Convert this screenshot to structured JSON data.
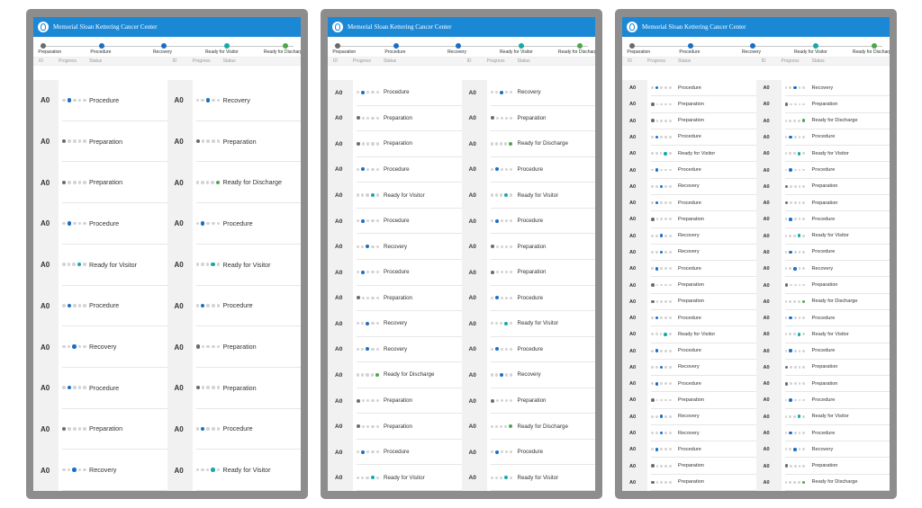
{
  "colors": {
    "header_bg": "#1b88d6",
    "preparation": "#6b6b6b",
    "procedure": "#1a6fc4",
    "recovery": "#1a6fc4",
    "ready_for_visitor": "#17a9a9",
    "ready_for_discharge": "#4ca84a",
    "inactive_dot": "#d3d3d3"
  },
  "stage_order": [
    "Preparation",
    "Procedure",
    "Recovery",
    "Ready for Visitor",
    "Ready for Discharge"
  ],
  "panels": [
    {
      "brand": "Memorial Sloan Kettering Cancer Center",
      "stages": [
        "Preparation",
        "Procedure",
        "Recovery",
        "Ready for Visitor",
        "Ready for Discharge"
      ],
      "columns": {
        "id": "ID",
        "progress": "Progress",
        "status": "Status"
      },
      "left": [
        {
          "id": "A0",
          "status": "Procedure"
        },
        {
          "id": "A0",
          "status": "Preparation"
        },
        {
          "id": "A0",
          "status": "Preparation"
        },
        {
          "id": "A0",
          "status": "Procedure"
        },
        {
          "id": "A0",
          "status": "Ready for Visitor"
        },
        {
          "id": "A0",
          "status": "Procedure"
        },
        {
          "id": "A0",
          "status": "Recovery"
        },
        {
          "id": "A0",
          "status": "Procedure"
        },
        {
          "id": "A0",
          "status": "Preparation"
        },
        {
          "id": "A0",
          "status": "Recovery"
        }
      ],
      "right": [
        {
          "id": "A0",
          "status": "Recovery"
        },
        {
          "id": "A0",
          "status": "Preparation"
        },
        {
          "id": "A0",
          "status": "Ready for Discharge"
        },
        {
          "id": "A0",
          "status": "Procedure"
        },
        {
          "id": "A0",
          "status": "Ready for Visitor"
        },
        {
          "id": "A0",
          "status": "Procedure"
        },
        {
          "id": "A0",
          "status": "Preparation"
        },
        {
          "id": "A0",
          "status": "Preparation"
        },
        {
          "id": "A0",
          "status": "Procedure"
        },
        {
          "id": "A0",
          "status": "Ready for Visitor"
        }
      ]
    },
    {
      "brand": "Memorial Sloan Kettering Cancer Center",
      "stages": [
        "Preparation",
        "Procedure",
        "Recovery",
        "Ready for Visitor",
        "Ready for Discharge"
      ],
      "columns": {
        "id": "ID",
        "progress": "Progress",
        "status": "Status"
      },
      "left": [
        {
          "id": "A0",
          "status": "Procedure"
        },
        {
          "id": "A0",
          "status": "Preparation"
        },
        {
          "id": "A0",
          "status": "Preparation"
        },
        {
          "id": "A0",
          "status": "Procedure"
        },
        {
          "id": "A0",
          "status": "Ready for Visitor"
        },
        {
          "id": "A0",
          "status": "Procedure"
        },
        {
          "id": "A0",
          "status": "Recovery"
        },
        {
          "id": "A0",
          "status": "Procedure"
        },
        {
          "id": "A0",
          "status": "Preparation"
        },
        {
          "id": "A0",
          "status": "Recovery"
        },
        {
          "id": "A0",
          "status": "Recovery"
        },
        {
          "id": "A0",
          "status": "Ready for Discharge"
        },
        {
          "id": "A0",
          "status": "Preparation"
        },
        {
          "id": "A0",
          "status": "Preparation"
        },
        {
          "id": "A0",
          "status": "Procedure"
        },
        {
          "id": "A0",
          "status": "Ready for Visitor"
        }
      ],
      "right": [
        {
          "id": "A0",
          "status": "Recovery"
        },
        {
          "id": "A0",
          "status": "Preparation"
        },
        {
          "id": "A0",
          "status": "Ready for Discharge"
        },
        {
          "id": "A0",
          "status": "Procedure"
        },
        {
          "id": "A0",
          "status": "Ready for Visitor"
        },
        {
          "id": "A0",
          "status": "Procedure"
        },
        {
          "id": "A0",
          "status": "Preparation"
        },
        {
          "id": "A0",
          "status": "Preparation"
        },
        {
          "id": "A0",
          "status": "Procedure"
        },
        {
          "id": "A0",
          "status": "Ready for Visitor"
        },
        {
          "id": "A0",
          "status": "Procedure"
        },
        {
          "id": "A0",
          "status": "Recovery"
        },
        {
          "id": "A0",
          "status": "Preparation"
        },
        {
          "id": "A0",
          "status": "Ready for Discharge"
        },
        {
          "id": "A0",
          "status": "Procedure"
        },
        {
          "id": "A0",
          "status": "Ready for Visitor"
        }
      ]
    },
    {
      "brand": "Memorial Sloan Kettering Cancer Center",
      "stages": [
        "Preparation",
        "Procedure",
        "Recovery",
        "Ready for Visitor",
        "Ready for Discharge"
      ],
      "columns": {
        "id": "ID",
        "progress": "Progress",
        "status": "Status"
      },
      "left": [
        {
          "id": "A0",
          "status": "Procedure"
        },
        {
          "id": "A0",
          "status": "Preparation"
        },
        {
          "id": "A0",
          "status": "Preparation"
        },
        {
          "id": "A0",
          "status": "Procedure"
        },
        {
          "id": "A0",
          "status": "Ready for Visitor"
        },
        {
          "id": "A0",
          "status": "Procedure"
        },
        {
          "id": "A0",
          "status": "Recovery"
        },
        {
          "id": "A0",
          "status": "Procedure"
        },
        {
          "id": "A0",
          "status": "Preparation"
        },
        {
          "id": "A0",
          "status": "Recovery"
        },
        {
          "id": "A0",
          "status": "Recovery"
        },
        {
          "id": "A0",
          "status": "Procedure"
        },
        {
          "id": "A0",
          "status": "Preparation"
        },
        {
          "id": "A0",
          "status": "Preparation"
        },
        {
          "id": "A0",
          "status": "Procedure"
        },
        {
          "id": "A0",
          "status": "Ready for Visitor"
        },
        {
          "id": "A0",
          "status": "Procedure"
        },
        {
          "id": "A0",
          "status": "Recovery"
        },
        {
          "id": "A0",
          "status": "Procedure"
        },
        {
          "id": "A0",
          "status": "Preparation"
        },
        {
          "id": "A0",
          "status": "Recovery"
        },
        {
          "id": "A0",
          "status": "Recovery"
        },
        {
          "id": "A0",
          "status": "Procedure"
        },
        {
          "id": "A0",
          "status": "Preparation"
        },
        {
          "id": "A0",
          "status": "Preparation"
        }
      ],
      "right": [
        {
          "id": "A0",
          "status": "Recovery"
        },
        {
          "id": "A0",
          "status": "Preparation"
        },
        {
          "id": "A0",
          "status": "Ready for Discharge"
        },
        {
          "id": "A0",
          "status": "Procedure"
        },
        {
          "id": "A0",
          "status": "Ready for Visitor"
        },
        {
          "id": "A0",
          "status": "Procedure"
        },
        {
          "id": "A0",
          "status": "Preparation"
        },
        {
          "id": "A0",
          "status": "Preparation"
        },
        {
          "id": "A0",
          "status": "Procedure"
        },
        {
          "id": "A0",
          "status": "Ready for Visitor"
        },
        {
          "id": "A0",
          "status": "Procedure"
        },
        {
          "id": "A0",
          "status": "Recovery"
        },
        {
          "id": "A0",
          "status": "Preparation"
        },
        {
          "id": "A0",
          "status": "Ready for Discharge"
        },
        {
          "id": "A0",
          "status": "Procedure"
        },
        {
          "id": "A0",
          "status": "Ready for Visitor"
        },
        {
          "id": "A0",
          "status": "Procedure"
        },
        {
          "id": "A0",
          "status": "Preparation"
        },
        {
          "id": "A0",
          "status": "Preparation"
        },
        {
          "id": "A0",
          "status": "Procedure"
        },
        {
          "id": "A0",
          "status": "Ready for Visitor"
        },
        {
          "id": "A0",
          "status": "Procedure"
        },
        {
          "id": "A0",
          "status": "Recovery"
        },
        {
          "id": "A0",
          "status": "Preparation"
        },
        {
          "id": "A0",
          "status": "Ready for Discharge"
        }
      ]
    }
  ]
}
